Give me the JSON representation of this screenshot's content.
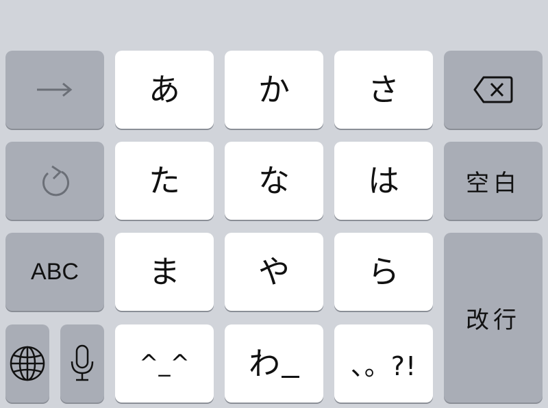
{
  "keyboard": {
    "row1": {
      "arrow_icon": "right-arrow-icon",
      "keys": [
        "あ",
        "か",
        "さ"
      ],
      "delete_icon": "delete-backspace-icon"
    },
    "row2": {
      "undo_icon": "undo-icon",
      "keys": [
        "た",
        "な",
        "は"
      ],
      "space_label": "空白"
    },
    "row3": {
      "abc_label": "ABC",
      "keys": [
        "ま",
        "や",
        "ら"
      ],
      "return_label": "改行"
    },
    "row4": {
      "globe_icon": "globe-icon",
      "mic_icon": "microphone-icon",
      "kaomoji_label": "^_^",
      "wa_label": "わ",
      "punct_label": "、。?!"
    }
  },
  "colors": {
    "background": "#d1d4da",
    "light_key": "#ffffff",
    "dark_key": "#a9adb6"
  }
}
